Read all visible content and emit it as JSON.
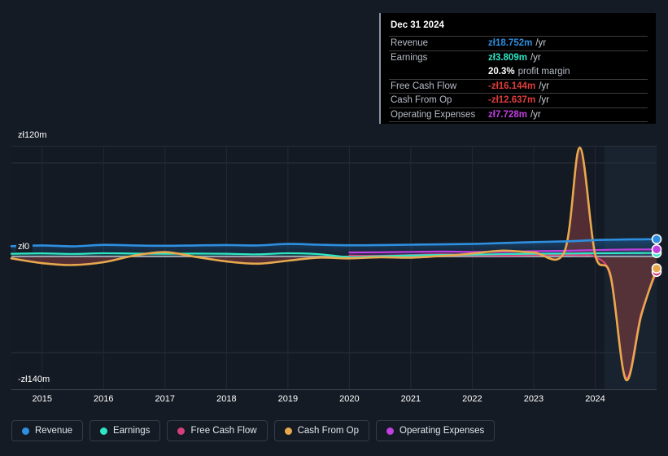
{
  "currency_symbol": "zł",
  "tooltip": {
    "date": "Dec 31 2024",
    "rows": [
      {
        "label": "Revenue",
        "value": "zł18.752m",
        "unit": "/yr",
        "color": "#2e8fe0"
      },
      {
        "label": "Earnings",
        "value": "zł3.809m",
        "unit": "/yr",
        "color": "#2ee6c5"
      },
      {
        "label": "",
        "value": "20.3%",
        "unit": "profit margin",
        "color": "#ffffff",
        "is_margin": true
      },
      {
        "label": "Free Cash Flow",
        "value": "-zł16.144m",
        "unit": "/yr",
        "color": "#e03c3c"
      },
      {
        "label": "Cash From Op",
        "value": "-zł12.637m",
        "unit": "/yr",
        "color": "#e03c3c"
      },
      {
        "label": "Operating Expenses",
        "value": "zł7.728m",
        "unit": "/yr",
        "color": "#c040e0"
      }
    ]
  },
  "legend": [
    {
      "label": "Revenue",
      "color": "#2e8fe0"
    },
    {
      "label": "Earnings",
      "color": "#2ee6c5"
    },
    {
      "label": "Free Cash Flow",
      "color": "#d6407a"
    },
    {
      "label": "Cash From Op",
      "color": "#e8a94e"
    },
    {
      "label": "Operating Expenses",
      "color": "#c040e0"
    }
  ],
  "axis": {
    "y_top": "zł120m",
    "y_zero": "zł0",
    "y_bottom": "-zł140m",
    "x_ticks": [
      "2015",
      "2016",
      "2017",
      "2018",
      "2019",
      "2020",
      "2021",
      "2022",
      "2023",
      "2024"
    ]
  },
  "chart_data": {
    "type": "area",
    "title": "",
    "xlabel": "",
    "ylabel": "",
    "ylim": [
      -140,
      120
    ],
    "grid": true,
    "legend_position": "bottom",
    "x": [
      2014.5,
      2015.0,
      2015.5,
      2016.0,
      2016.5,
      2017.0,
      2017.5,
      2018.0,
      2018.5,
      2019.0,
      2019.5,
      2020.0,
      2020.5,
      2021.0,
      2021.5,
      2022.0,
      2022.5,
      2023.0,
      2023.5,
      2023.75,
      2024.0,
      2024.25,
      2024.5,
      2024.75,
      2025.0
    ],
    "x_tick_values": [
      2015,
      2016,
      2017,
      2018,
      2019,
      2020,
      2021,
      2022,
      2023,
      2024
    ],
    "forecast_start_x": 2024.15,
    "series": [
      {
        "name": "Revenue",
        "color": "#2e8fe0",
        "values": [
          11.2,
          12.0,
          11.0,
          12.6,
          12.0,
          11.6,
          12.0,
          12.4,
          12.0,
          13.6,
          12.8,
          12.2,
          12.4,
          12.8,
          13.2,
          13.6,
          14.6,
          15.6,
          16.4,
          17.0,
          17.8,
          18.2,
          18.5,
          18.6,
          18.752
        ]
      },
      {
        "name": "Earnings",
        "color": "#2ee6c5",
        "values": [
          3.0,
          3.4,
          2.8,
          3.6,
          3.2,
          3.0,
          3.2,
          3.0,
          2.4,
          3.6,
          2.6,
          -0.6,
          0.4,
          1.2,
          1.8,
          2.0,
          2.6,
          3.0,
          3.2,
          3.3,
          3.5,
          3.6,
          3.7,
          3.78,
          3.809
        ]
      },
      {
        "name": "Free Cash Flow",
        "color": "#d6407a",
        "values": [
          null,
          null,
          null,
          null,
          null,
          null,
          null,
          null,
          null,
          null,
          null,
          1.0,
          0.8,
          1.6,
          2.4,
          1.4,
          1.0,
          1.6,
          2.0,
          1.4,
          -0.6,
          -22.0,
          -128.0,
          -60.0,
          -16.144
        ]
      },
      {
        "name": "Cash From Op",
        "color": "#e8a94e",
        "values": [
          -2.0,
          -7.0,
          -9.0,
          -6.0,
          1.0,
          4.8,
          -0.4,
          -5.2,
          -7.6,
          -4.4,
          -1.2,
          -2.0,
          -0.8,
          -1.2,
          0.6,
          3.2,
          6.4,
          4.4,
          5.2,
          118.0,
          2.0,
          -20.0,
          -130.0,
          -62.0,
          -12.637
        ]
      },
      {
        "name": "Operating Expenses",
        "color": "#c040e0",
        "values": [
          null,
          null,
          null,
          null,
          null,
          null,
          null,
          null,
          null,
          null,
          null,
          4.4,
          4.6,
          5.0,
          5.4,
          5.0,
          5.2,
          5.8,
          6.2,
          6.6,
          7.0,
          7.3,
          7.5,
          7.65,
          7.728
        ]
      }
    ]
  }
}
